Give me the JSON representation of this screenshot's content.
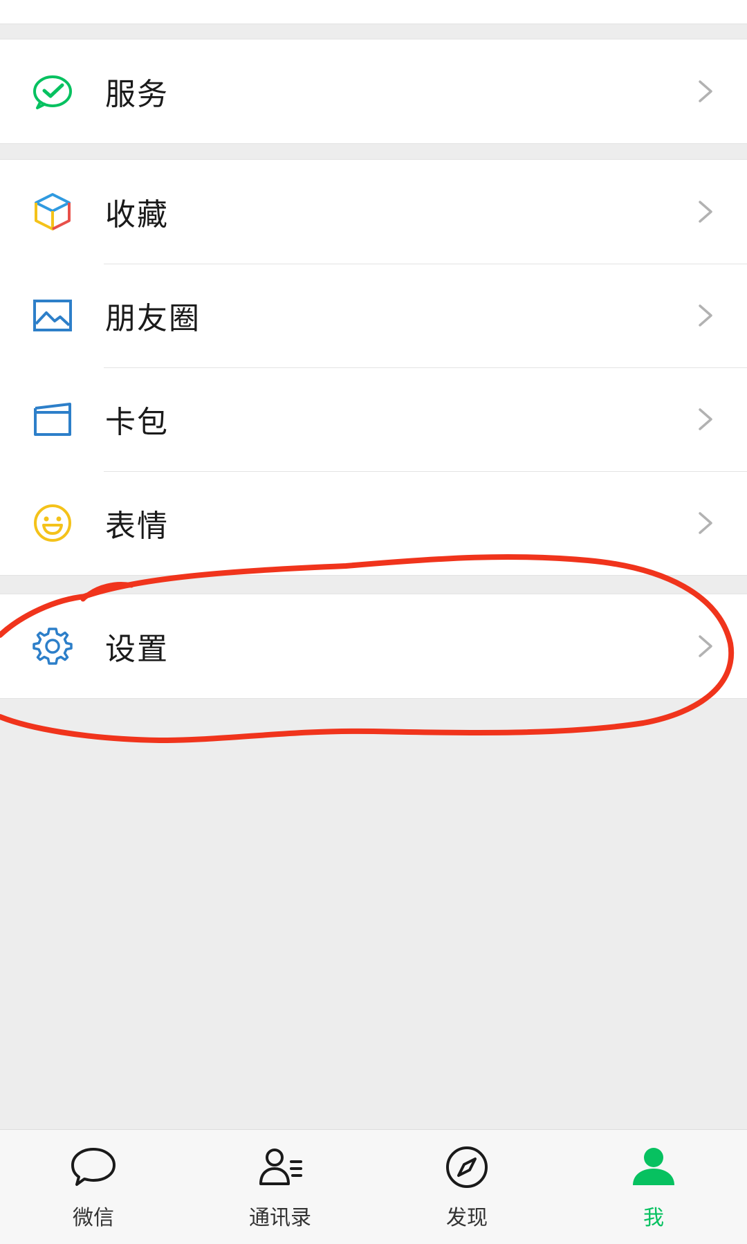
{
  "colors": {
    "background": "#ededed",
    "row_background": "#ffffff",
    "wechat_green": "#07c160",
    "annotation_red": "#f0341c"
  },
  "menu": {
    "services": {
      "label": "服务",
      "icon": "services-check-icon"
    },
    "favorites": {
      "label": "收藏",
      "icon": "favorites-cube-icon"
    },
    "moments": {
      "label": "朋友圈",
      "icon": "moments-picture-icon"
    },
    "cards": {
      "label": "卡包",
      "icon": "card-wallet-icon"
    },
    "stickers": {
      "label": "表情",
      "icon": "smiley-icon"
    },
    "settings": {
      "label": "设置",
      "icon": "gear-icon"
    }
  },
  "tabbar": {
    "tabs": [
      {
        "label": "微信",
        "icon": "chat-bubble-icon",
        "active": false
      },
      {
        "label": "通讯录",
        "icon": "contacts-icon",
        "active": false
      },
      {
        "label": "发现",
        "icon": "compass-icon",
        "active": false
      },
      {
        "label": "我",
        "icon": "person-icon",
        "active": true
      }
    ]
  }
}
